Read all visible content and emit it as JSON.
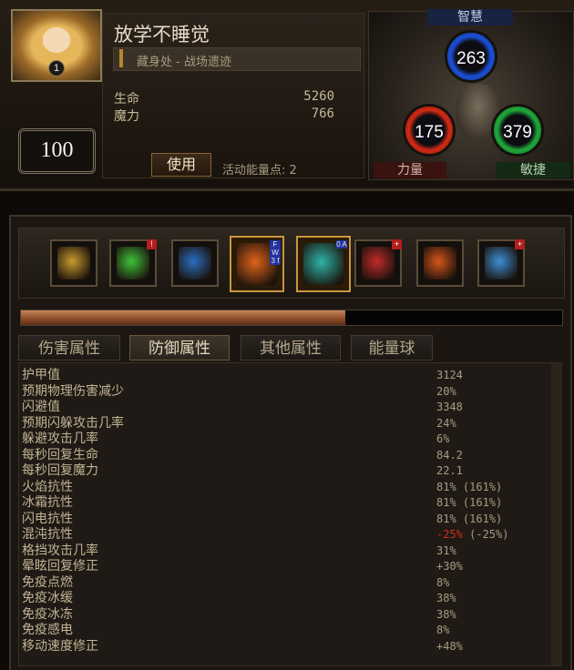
{
  "character": {
    "name": "放学不睡觉",
    "location": "藏身处 - 战场遗迹",
    "level": "100",
    "portrait_level": "1",
    "life_label": "生命",
    "life_value": "5260",
    "mana_label": "魔力",
    "mana_value": "766",
    "use_button_label": "使用",
    "points_text": "活动能量点: 2"
  },
  "attributes": {
    "intelligence_label": "智慧",
    "intelligence_value": "263",
    "strength_label": "力量",
    "strength_value": "175",
    "dexterity_label": "敏捷",
    "dexterity_value": "379"
  },
  "gems": [
    {
      "icon": "dagger-gem-icon",
      "color": "#c89a2e",
      "badge": ""
    },
    {
      "icon": "green-ring-gem-icon",
      "color": "#3fc23a",
      "badge": "!"
    },
    {
      "icon": "blue-rune-gem-icon",
      "color": "#2c6ec2",
      "badge": ""
    },
    {
      "icon": "fire-gem-icon",
      "color": "#e0631a",
      "badge": "",
      "side_text": "F W 3 f"
    },
    {
      "icon": "teal-creature-gem-icon",
      "color": "#2fb3a8",
      "badge": "",
      "side_text": "0 A"
    },
    {
      "icon": "red-figure-gem-icon",
      "color": "#c22a2a",
      "badge": "+"
    },
    {
      "icon": "fist-gem-icon",
      "color": "#d6551c",
      "badge": ""
    },
    {
      "icon": "blue-spirit-gem-icon",
      "color": "#3d8fd6",
      "badge": "+"
    }
  ],
  "progress": {
    "fraction": 0.6
  },
  "tabs": [
    "伤害属性",
    "防御属性",
    "其他属性",
    "能量球"
  ],
  "active_tab": "防御属性",
  "stats": [
    {
      "name": "护甲值",
      "value": "3124"
    },
    {
      "name": "预期物理伤害减少",
      "value": "20%"
    },
    {
      "name": "闪避值",
      "value": "3348"
    },
    {
      "name": "预期闪躲攻击几率",
      "value": "24%"
    },
    {
      "name": "躲避攻击几率",
      "value": "6%"
    },
    {
      "name": "每秒回复生命",
      "value": "84.2"
    },
    {
      "name": "每秒回复魔力",
      "value": "22.1"
    },
    {
      "name": "火焰抗性",
      "value": "81% (161%)"
    },
    {
      "name": "冰霜抗性",
      "value": "81% (161%)"
    },
    {
      "name": "闪电抗性",
      "value": "81% (161%)"
    },
    {
      "name": "混沌抗性",
      "value": "-25%",
      "extra": " (-25%)"
    },
    {
      "name": "格挡攻击几率",
      "value": "31%"
    },
    {
      "name": "晕眩回复修正",
      "value": "+30%"
    },
    {
      "name": "免疫点燃",
      "value": "8%"
    },
    {
      "name": "免疫冰缓",
      "value": "38%"
    },
    {
      "name": "免疫冰冻",
      "value": "38%"
    },
    {
      "name": "免疫感电",
      "value": "8%"
    },
    {
      "name": "移动速度修正",
      "value": "+48%"
    }
  ],
  "colors": {
    "accent": "#c8973c",
    "negative": "#d82b1f"
  }
}
